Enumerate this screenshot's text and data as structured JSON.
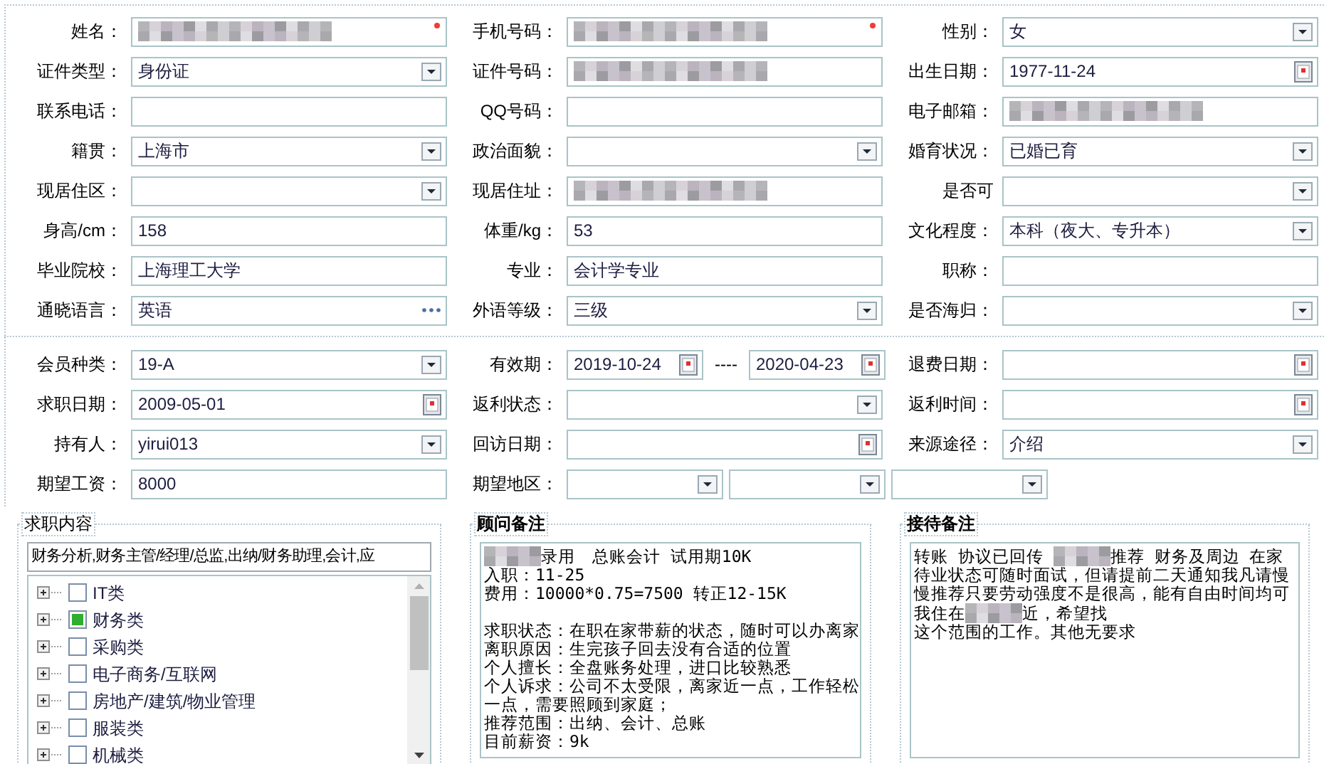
{
  "personal_rows": [
    [
      {
        "label": "姓名：",
        "kind": "text",
        "masked": true,
        "required": true
      },
      {
        "label": "手机号码：",
        "kind": "text",
        "masked": true,
        "required": true
      },
      {
        "label": "性别：",
        "kind": "select",
        "value": "女"
      }
    ],
    [
      {
        "label": "证件类型：",
        "kind": "select",
        "value": "身份证"
      },
      {
        "label": "证件号码：",
        "kind": "text",
        "masked": true
      },
      {
        "label": "出生日期：",
        "kind": "date",
        "value": "1977-11-24"
      }
    ],
    [
      {
        "label": "联系电话：",
        "kind": "text"
      },
      {
        "label": "QQ号码：",
        "kind": "text"
      },
      {
        "label": "电子邮箱：",
        "kind": "text",
        "masked": true
      }
    ],
    [
      {
        "label": "籍贯：",
        "kind": "select",
        "value": "上海市"
      },
      {
        "label": "政治面貌：",
        "kind": "select"
      },
      {
        "label": "婚育状况：",
        "kind": "select",
        "value": "已婚已育"
      }
    ],
    [
      {
        "label": "现居住区：",
        "kind": "select"
      },
      {
        "label": "现居住址：",
        "kind": "text",
        "masked": true
      },
      {
        "label": "是否可",
        "kind": "select"
      }
    ],
    [
      {
        "label": "身高/cm：",
        "kind": "text",
        "value": "158"
      },
      {
        "label": "体重/kg：",
        "kind": "text",
        "value": "53"
      },
      {
        "label": "文化程度：",
        "kind": "select",
        "value": "本科（夜大、专升本）"
      }
    ],
    [
      {
        "label": "毕业院校：",
        "kind": "text",
        "value": "上海理工大学"
      },
      {
        "label": "专业：",
        "kind": "text",
        "value": "会计学专业"
      },
      {
        "label": "职称：",
        "kind": "text"
      }
    ],
    [
      {
        "label": "通晓语言：",
        "kind": "lookup",
        "value": "英语"
      },
      {
        "label": "外语等级：",
        "kind": "select",
        "value": "三级"
      },
      {
        "label": "是否海归：",
        "kind": "select"
      }
    ]
  ],
  "membership_rows": [
    [
      {
        "label": "会员种类：",
        "kind": "select",
        "value": "19-A"
      },
      {
        "label": "有效期：",
        "kind": "range",
        "separator": "----",
        "parts": [
          {
            "kind": "date",
            "value": "2019-10-24"
          },
          {
            "kind": "date",
            "value": "2020-04-23"
          }
        ]
      },
      {
        "label": "退费日期：",
        "kind": "date"
      }
    ],
    [
      {
        "label": "求职日期：",
        "kind": "date",
        "value": "2009-05-01"
      },
      {
        "label": "返利状态：",
        "kind": "select"
      },
      {
        "label": "返利时间：",
        "kind": "date"
      }
    ],
    [
      {
        "label": "持有人：",
        "kind": "select",
        "value": "yirui013"
      },
      {
        "label": "回访日期：",
        "kind": "date"
      },
      {
        "label": "来源途径：",
        "kind": "select",
        "value": "介绍"
      }
    ],
    [
      {
        "label": "期望工资：",
        "kind": "text",
        "value": "8000"
      },
      {
        "label": "期望地区：",
        "kind": "range",
        "parts": [
          {
            "kind": "select"
          },
          {
            "kind": "select"
          },
          {
            "kind": "select"
          }
        ]
      }
    ]
  ],
  "job_intent": {
    "legend": "求职内容",
    "summary": "财务分析,财务主管/经理/总监,出纳/财务助理,会计,应",
    "tree": [
      {
        "label": "IT类",
        "checked": false,
        "expanded": false
      },
      {
        "label": "财务类",
        "checked": true,
        "expanded": false
      },
      {
        "label": "采购类",
        "checked": false,
        "expanded": false
      },
      {
        "label": "电子商务/互联网",
        "checked": false,
        "expanded": false
      },
      {
        "label": "房地产/建筑/物业管理",
        "checked": false,
        "expanded": false
      },
      {
        "label": "服装类",
        "checked": false,
        "expanded": false
      },
      {
        "label": "机械类",
        "checked": false,
        "expanded": false
      }
    ]
  },
  "notes": [
    {
      "legend": "顾问备注",
      "paragraphs": [
        [
          [
            {
              "kind": "mosaic"
            },
            {
              "text": "录用　总账会计 试用期10K"
            }
          ],
          "入职：11-25",
          "费用：10000*0.75=7500 转正12-15K"
        ],
        [
          "求职状态：在职在家带薪的状态，随时可以办离家",
          "离职原因：生完孩子回去没有合适的位置",
          "个人擅长：全盘账务处理，进口比较熟悉",
          "个人诉求：公司不太受限，离家近一点，工作轻松",
          "一点，需要照顾到家庭；",
          "推荐范围：出纳、会计、总账",
          "目前薪资：9k"
        ]
      ]
    },
    {
      "legend": "接待备注",
      "paragraphs": [
        [
          [
            {
              "text": "转账 协议已回传 "
            },
            {
              "kind": "mosaic"
            },
            {
              "text": "推荐 财务及周边 在家"
            }
          ],
          "待业状态可随时面试，但请提前二天通知我凡请慢",
          "慢推荐只要劳动强度不是很高，能有自由时间均可",
          [
            {
              "text": "我住在"
            },
            {
              "kind": "mosaic"
            },
            {
              "text": "近，希望找"
            }
          ],
          "这个范围的工作。其他无要求"
        ]
      ]
    }
  ]
}
